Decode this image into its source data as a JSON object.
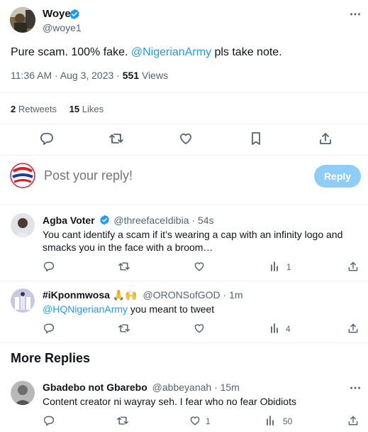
{
  "tweet": {
    "author_name": "Woye",
    "author_handle": "@woye1",
    "text_before": "Pure scam. 100% fake. ",
    "mention": "@NigerianArmy",
    "text_after": " pls take note.",
    "time": "11:36 AM · Aug 3, 2023 · ",
    "views_count": "551",
    "views_label": " Views",
    "retweets_count": "2",
    "retweets_label": " Retweets",
    "likes_count": "15",
    "likes_label": " Likes"
  },
  "icons": {
    "reply": "reply-icon",
    "retweet": "retweet-icon",
    "like": "heart-icon",
    "bookmark": "bookmark-icon",
    "share": "share-icon",
    "views": "views-icon",
    "more": "more-icon",
    "verified": "verified-badge-icon"
  },
  "composer": {
    "placeholder": "Post your reply!",
    "button": "Reply"
  },
  "replies": [
    {
      "name": "Agba Voter",
      "verified": true,
      "handle": "@threefaceIdibia · 54s",
      "text": "You cant identify a scam if it’s wearing a cap with an infinity logo and smacks you in the face with a broom…",
      "views": "1"
    },
    {
      "name": "#iKponmwosa 🙏🙌",
      "handle": "@ORONSofGOD · 1m",
      "mention": "@HQNigerianArmy",
      "text": " you meant to tweet",
      "views": "4"
    }
  ],
  "more_replies": {
    "title": "More Replies",
    "items": [
      {
        "name": "Gbadebo not Gbarebo",
        "handle": "@abbeyanah · 15m",
        "text": "Content creator ni wayray seh. I fear who no fear Obidiots",
        "likes": "1",
        "views": "50"
      }
    ]
  },
  "colors": {
    "accent": "#1d9bf0",
    "reply_button_disabled": "#8ecdf8",
    "muted_text": "#536471",
    "divider": "#eff3f4"
  }
}
